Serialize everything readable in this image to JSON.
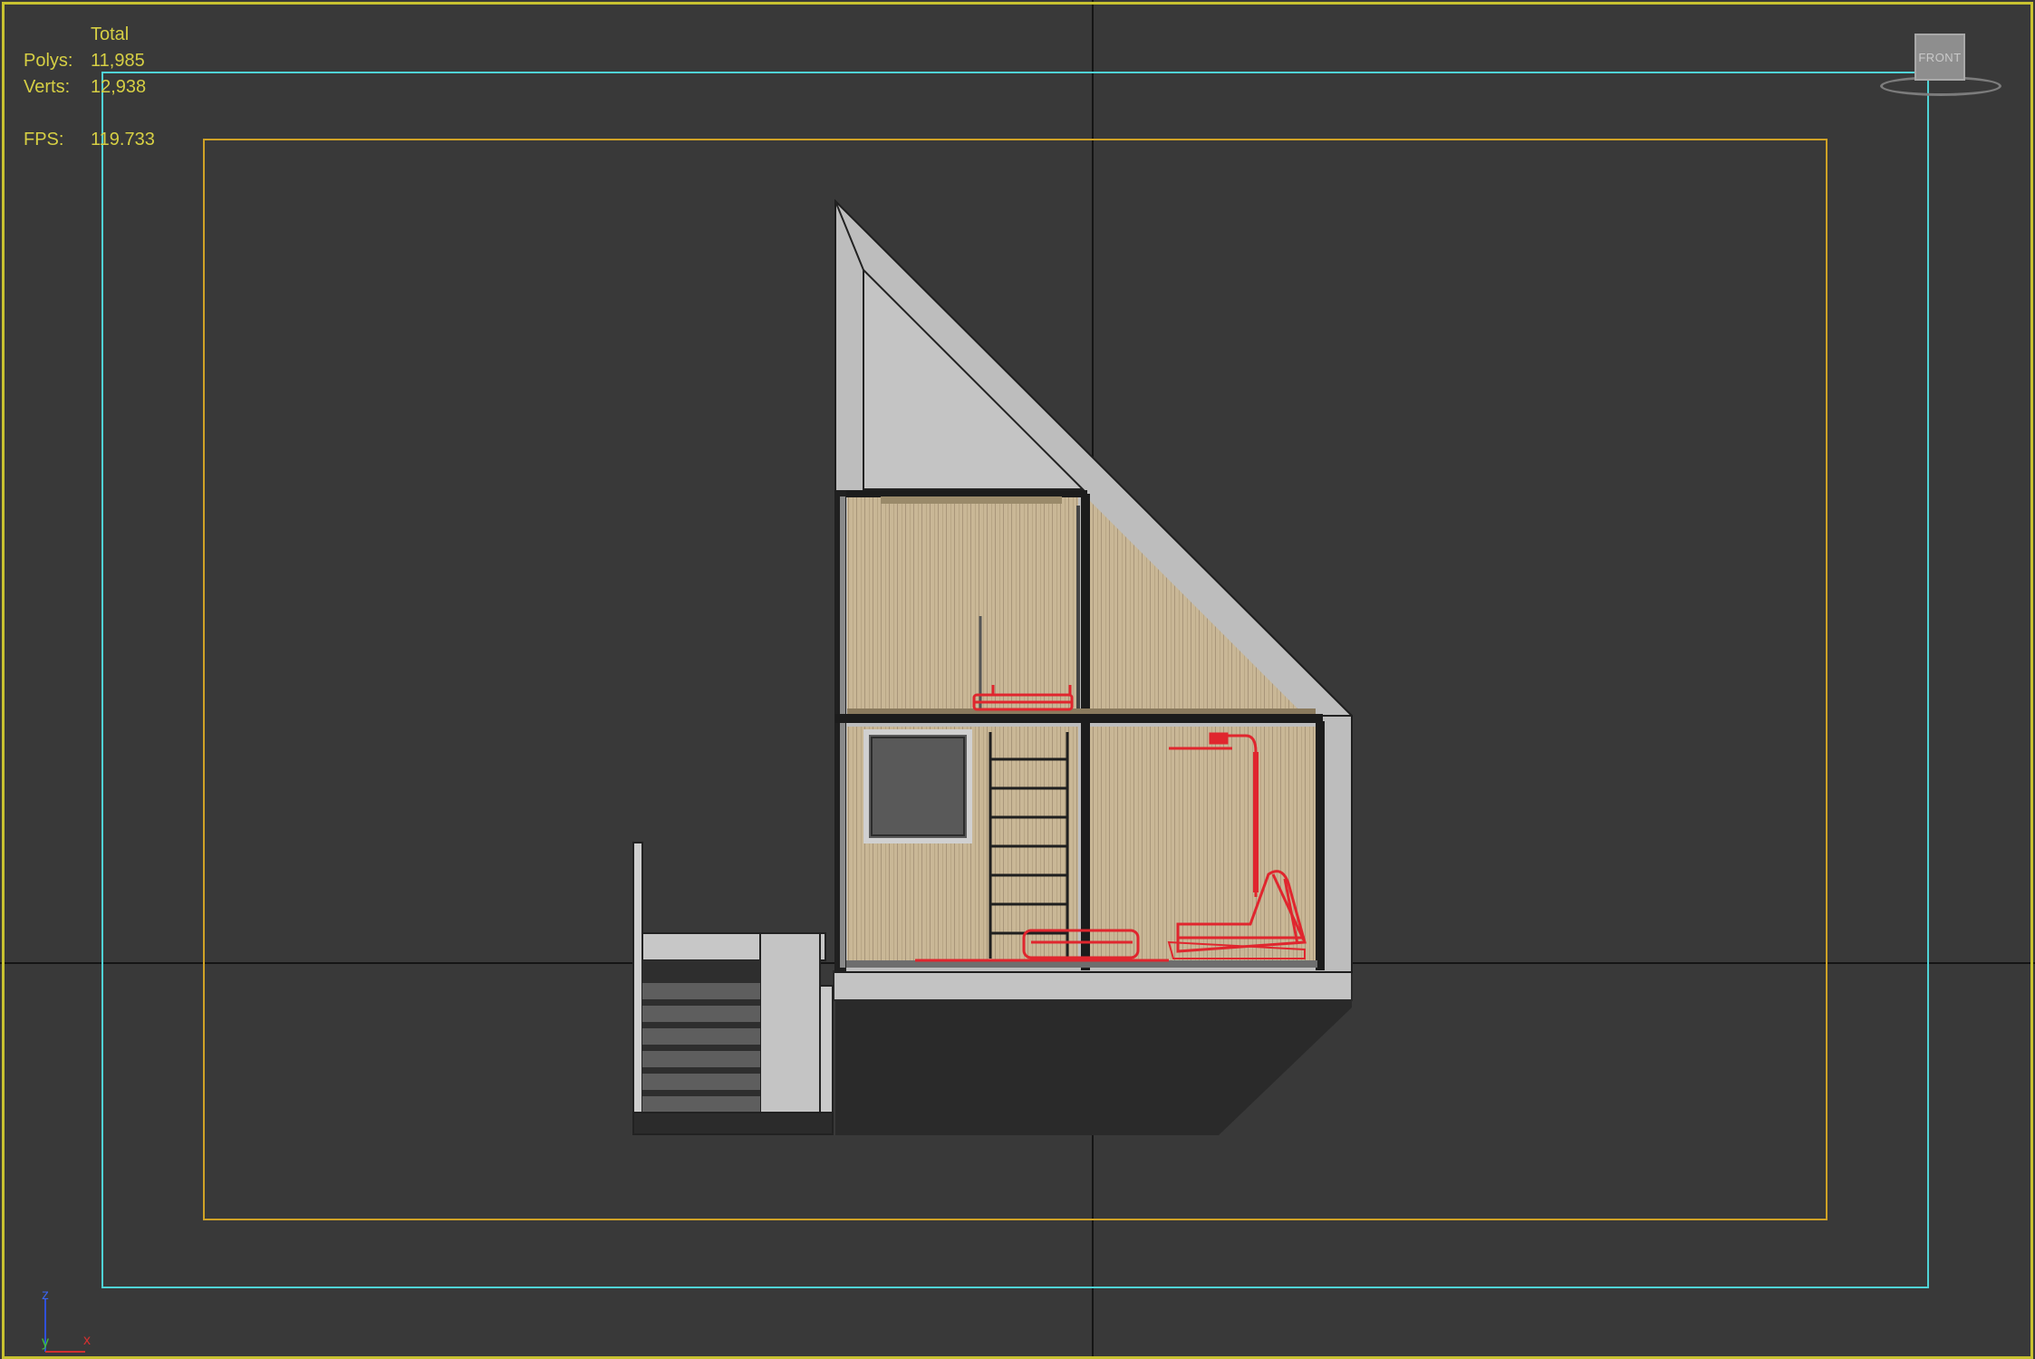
{
  "viewport": {
    "label": "FRONT",
    "stats": {
      "total_label": "Total",
      "polys_label": "Polys:",
      "polys_value": "11,985",
      "verts_label": "Verts:",
      "verts_value": "12,938",
      "fps_label": "FPS:",
      "fps_value": "119.733"
    },
    "axis_labels": {
      "z": "z",
      "y": "y",
      "x": "x"
    },
    "colors": {
      "background": "#393939",
      "active_border": "#c8c230",
      "safe_frame": "#4fd3d6",
      "action_safe": "#cfa226",
      "wireframe": "#e0262e",
      "wood": "#c7b595",
      "stats_text": "#d6cf44"
    }
  }
}
